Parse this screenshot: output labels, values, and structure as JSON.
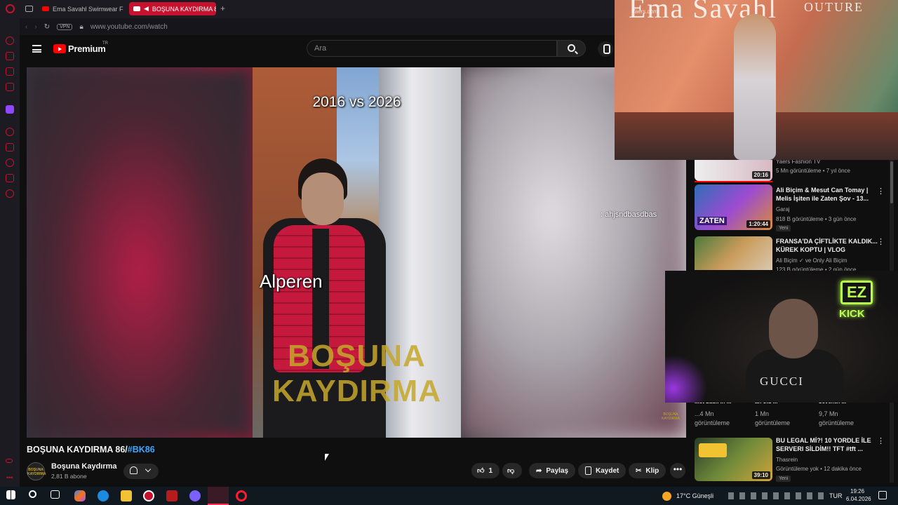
{
  "browser": {
    "tabs": [
      {
        "label": "Ema Savahl Swimwear Fa"
      },
      {
        "label": "BOŞUNA KAYDIRMA 8"
      }
    ],
    "new_tab": "+",
    "vpn": "VPN",
    "url": "www.youtube.com/watch"
  },
  "youtube": {
    "logo": "Premium",
    "logo_region": "TR",
    "search_placeholder": "Ara",
    "video": {
      "overlay_title": "2016 vs 2026",
      "overlay_name": "Alperen",
      "brand_line1": "BOŞUNA",
      "brand_line2": "KAYDIRMA",
      "chat_message": ": ahjsndbasdbas",
      "watermark": "BOŞUNA KAYDIRMA"
    },
    "title_main": "BOŞUNA KAYDIRMA 86/",
    "title_tag": "#BK86",
    "channel": {
      "name": "Boşuna Kaydırma",
      "subs": "2,81 B abone",
      "avatar_text": "BOŞUNA KAYDIRMA"
    },
    "actions": {
      "like_count": "1",
      "share": "Paylaş",
      "save": "Kaydet",
      "clip": "Klip",
      "more": "•••"
    }
  },
  "recommendations": [
    {
      "channel": "Yaers Fashion TV",
      "meta": "5 Mn görüntüleme • 7 yıl önce",
      "duration": "20:16"
    },
    {
      "title": "Ali Biçim & Mesut Can Tomay | Melis İşiten ile Zaten Şov - 13...",
      "channel": "Garaj",
      "meta": "818 B görüntüleme • 3 gün önce",
      "duration": "1:20:44",
      "badge": "Yeni",
      "thumb_text": "ZATEN"
    },
    {
      "title": "FRANSA'DA ÇİFTLİKTE KALDIK... KÜREK KOPTU | VLOG",
      "channel": "Ali Biçim ✓ ve Only Ali Biçim",
      "meta": "123 B görüntüleme • 2 gün önce"
    },
    {
      "title": "BU LEGAL Mİ?! 10 YORDLE İLE SERVERI SİLDİM!! TFT #tft ...",
      "channel": "Thasrein",
      "meta": "Görüntüleme yok • 12 dakika önce",
      "duration": "39:10",
      "badge": "Yeni"
    }
  ],
  "shorts_row": [
    {
      "title": "...et back in ...",
      "views": "...4 Mn",
      "sub": "görüntüleme"
    },
    {
      "title": "an old ...",
      "views": "1 Mn",
      "sub": "görüntüleme"
    },
    {
      "title": "seventh ...",
      "views": "9,7 Mn",
      "sub": "görüntüleme"
    }
  ],
  "overlays": {
    "fashion_watermark": "Yaers.com",
    "fashion_banner": "Ema Savahl",
    "fashion_banner2": "OUTURE",
    "cam_shirt": "GUCCI",
    "ez": "EZ",
    "kick": "KICK"
  },
  "taskbar": {
    "weather": "17°C  Güneşli",
    "lang": "TUR",
    "time": "19:26",
    "date": "6.04.2026"
  }
}
